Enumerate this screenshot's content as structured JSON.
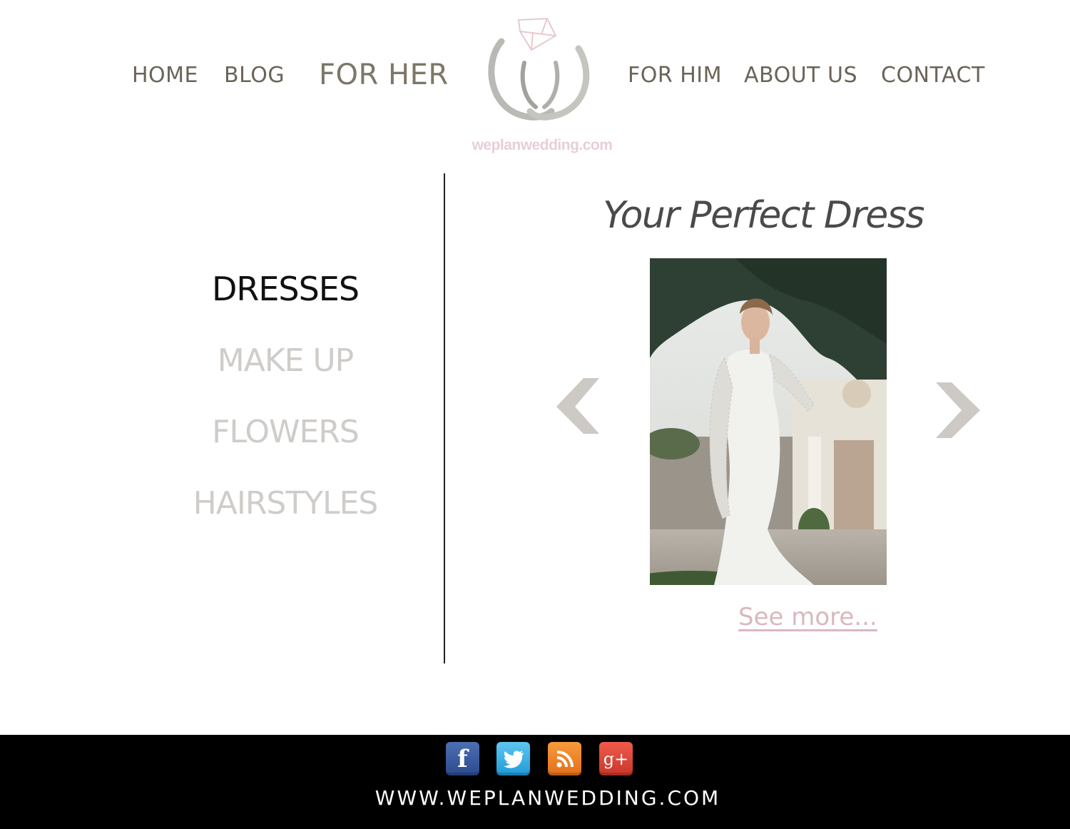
{
  "nav": {
    "home": "HOME",
    "blog": "BLOG",
    "for_her": "FOR HER",
    "for_him": "FOR HIM",
    "about": "ABOUT US",
    "contact": "CONTACT"
  },
  "logo": {
    "text": "weplanwedding.com",
    "icon": "rings-diamond-icon"
  },
  "sidebar": {
    "items": [
      {
        "label": "DRESSES",
        "active": true
      },
      {
        "label": "MAKE UP",
        "active": false
      },
      {
        "label": "FLOWERS",
        "active": false
      },
      {
        "label": "HAIRSTYLES",
        "active": false
      }
    ]
  },
  "main": {
    "title": "Your Perfect Dress",
    "see_more": "See more...",
    "prev_icon": "chevron-left-icon",
    "next_icon": "chevron-right-icon",
    "photo": "bride-in-lace-dress-photo"
  },
  "footer": {
    "social": [
      "facebook-icon",
      "twitter-icon",
      "rss-icon",
      "google-plus-icon"
    ],
    "url": "WWW.WEPLANWEDDING.COM"
  },
  "colors": {
    "nav_text": "#6b6458",
    "inactive_side": "#cfccc9",
    "link_pink": "#d9b8bf",
    "footer_bg": "#000000"
  }
}
